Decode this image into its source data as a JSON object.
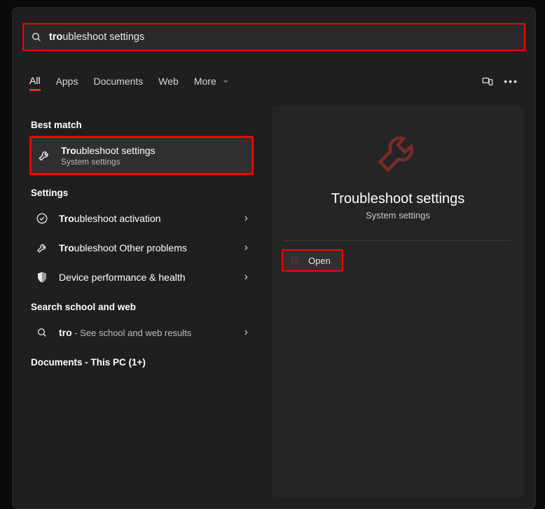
{
  "search": {
    "query_bold": "tro",
    "query_rest": "ubleshoot settings"
  },
  "filters": {
    "all": "All",
    "apps": "Apps",
    "documents": "Documents",
    "web": "Web",
    "more": "More"
  },
  "sections": {
    "best_match": "Best match",
    "settings": "Settings",
    "search_web": "Search school and web",
    "documents_pc": "Documents - This PC (1+)"
  },
  "best_match_item": {
    "title_bold": "Tro",
    "title_rest": "ubleshoot settings",
    "subtitle": "System settings"
  },
  "settings_items": [
    {
      "title_bold": "Tro",
      "title_rest": "ubleshoot activation",
      "icon": "check"
    },
    {
      "title_bold": "Tro",
      "title_rest": "ubleshoot Other problems",
      "icon": "wrench"
    },
    {
      "title_bold": "",
      "title_rest": "Device performance & health",
      "icon": "shield"
    }
  ],
  "web_item": {
    "title_bold": "tro",
    "rest_prefix": " - ",
    "rest_text": "See school and web results"
  },
  "panel": {
    "title": "Troubleshoot settings",
    "subtitle": "System settings",
    "open": "Open"
  }
}
